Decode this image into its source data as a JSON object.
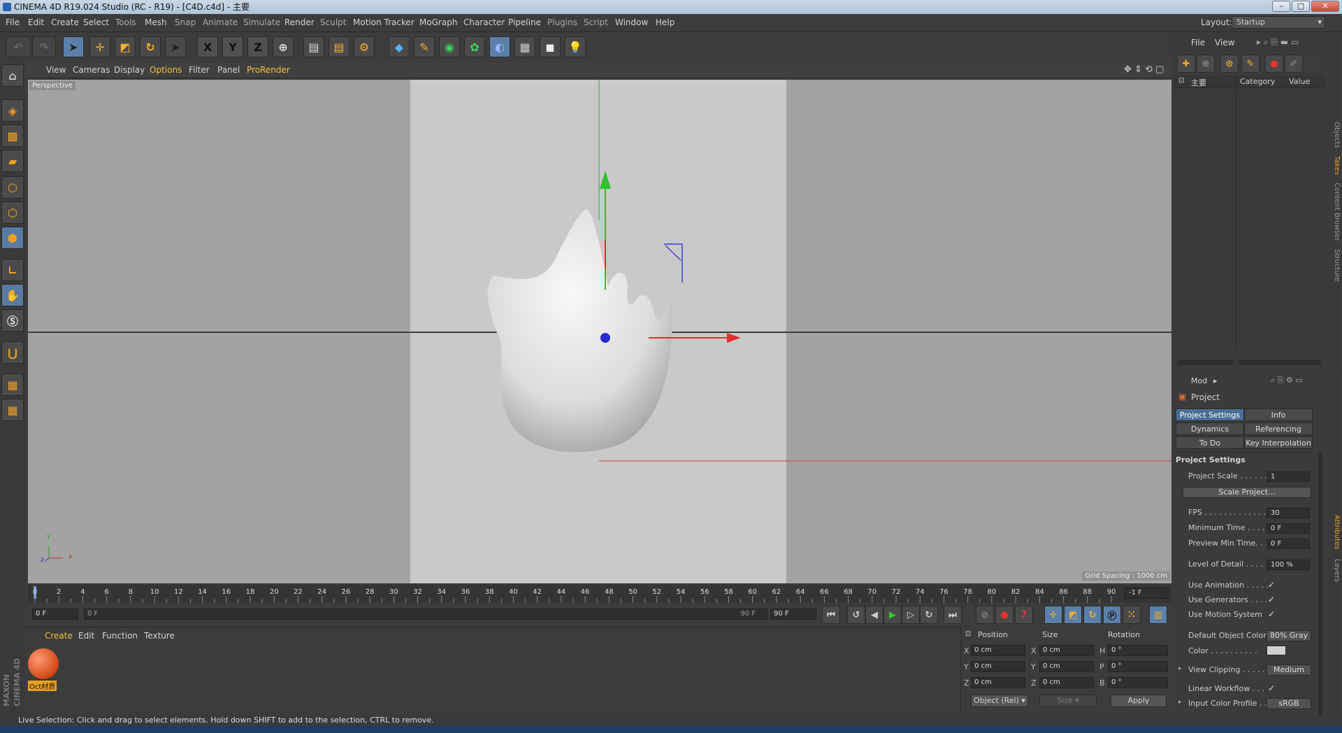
{
  "window": {
    "title": "CINEMA 4D R19.024 Studio (RC - R19) - [C4D.c4d] - 主要"
  },
  "menubar": {
    "items": [
      "File",
      "Edit",
      "Create",
      "Select",
      "Tools",
      "Mesh",
      "Snap",
      "Animate",
      "Simulate",
      "Render",
      "Sculpt",
      "Motion Tracker",
      "MoGraph",
      "Character",
      "Pipeline",
      "Plugins",
      "Script",
      "Window",
      "Help"
    ],
    "layout_label": "Layout:",
    "layout_value": "Startup"
  },
  "toolbar": {
    "axis_x": "X",
    "axis_y": "Y",
    "axis_z": "Z"
  },
  "viewport": {
    "menu": [
      "View",
      "Cameras",
      "Display",
      "Options",
      "Filter",
      "Panel",
      "ProRender"
    ],
    "label": "Perspective",
    "grid_spacing": "Grid Spacing : 1000 cm",
    "axis_y_label": "y",
    "axis_x_label": "x",
    "axis_z_label": "z"
  },
  "objects_panel": {
    "menu": [
      "File",
      "View"
    ],
    "col_name": "主要",
    "col_category": "Category",
    "col_value": "Value",
    "side_tabs": [
      "Objects",
      "Takes",
      "Content Browser",
      "Structure"
    ]
  },
  "attributes": {
    "mode_label": "Mod",
    "header": "Project",
    "tabs": [
      "Project Settings",
      "Info",
      "Dynamics",
      "Referencing",
      "To Do",
      "Key Interpolation"
    ],
    "section": "Project Settings",
    "rows": {
      "project_scale_label": "Project Scale . . . . . .",
      "project_scale_value": "1",
      "scale_project_button": "Scale Project...",
      "fps_label": "FPS . . . . . . . . . . . . . .",
      "fps_value": "30",
      "min_time_label": "Minimum Time . . . . .",
      "min_time_value": "0 F",
      "preview_min_label": "Preview Min Time. . .",
      "preview_min_value": "0 F",
      "lod_label": "Level of Detail . . . . .",
      "lod_value": "100 %",
      "use_animation_label": "Use Animation . . . . .",
      "use_generators_label": "Use Generators . . . .",
      "use_motion_label": "Use Motion System",
      "default_color_label": "Default Object Color",
      "default_color_value": "80% Gray",
      "color_label": "Color . . . . . . . . . .",
      "view_clipping_label": "View Clipping . . . . .",
      "view_clipping_value": "Medium",
      "linear_workflow_label": "Linear Workflow . . .",
      "input_profile_label": "Input Color Profile . .",
      "input_profile_value": "sRGB",
      "check_mark": "✓"
    },
    "side_tabs": [
      "Attributes",
      "Layers"
    ]
  },
  "timeline": {
    "ticks": [
      "0",
      "2",
      "4",
      "6",
      "8",
      "10",
      "12",
      "14",
      "16",
      "18",
      "20",
      "22",
      "24",
      "26",
      "28",
      "30",
      "32",
      "34",
      "36",
      "38",
      "40",
      "42",
      "44",
      "46",
      "48",
      "50",
      "52",
      "54",
      "56",
      "58",
      "60",
      "62",
      "64",
      "66",
      "68",
      "70",
      "72",
      "74",
      "76",
      "78",
      "80",
      "82",
      "84",
      "86",
      "88",
      "90"
    ],
    "current_frame_display": "-1 F",
    "start_field": "0 F",
    "range_start": "0 F",
    "range_end": "90 F",
    "end_field": "90 F"
  },
  "material_manager": {
    "menu": [
      "Create",
      "Edit",
      "Function",
      "Texture"
    ],
    "material_name": "Oct材质"
  },
  "coordinates": {
    "headers": [
      "Position",
      "Size",
      "Rotation"
    ],
    "pos": [
      "0 cm",
      "0 cm",
      "0 cm"
    ],
    "size": [
      "0 cm",
      "0 cm",
      "0 cm"
    ],
    "rot": [
      "0 °",
      "0 °",
      "0 °"
    ],
    "axis_labels": [
      "X",
      "Y",
      "Z"
    ],
    "rot_labels": [
      "H",
      "P",
      "B"
    ],
    "mode": "Object (Rel)",
    "size_mode": "Size",
    "apply": "Apply"
  },
  "status": {
    "text": "Live Selection: Click and drag to select elements. Hold down SHIFT to add to the selection, CTRL to remove."
  },
  "brand": {
    "line1": "MAXON",
    "line2": "CINEMA 4D"
  },
  "colors": {
    "accent": "#4b6e96",
    "x_axis": "#e02020",
    "y_axis": "#20c020",
    "z_axis": "#2020e0",
    "material": "#e06030"
  }
}
